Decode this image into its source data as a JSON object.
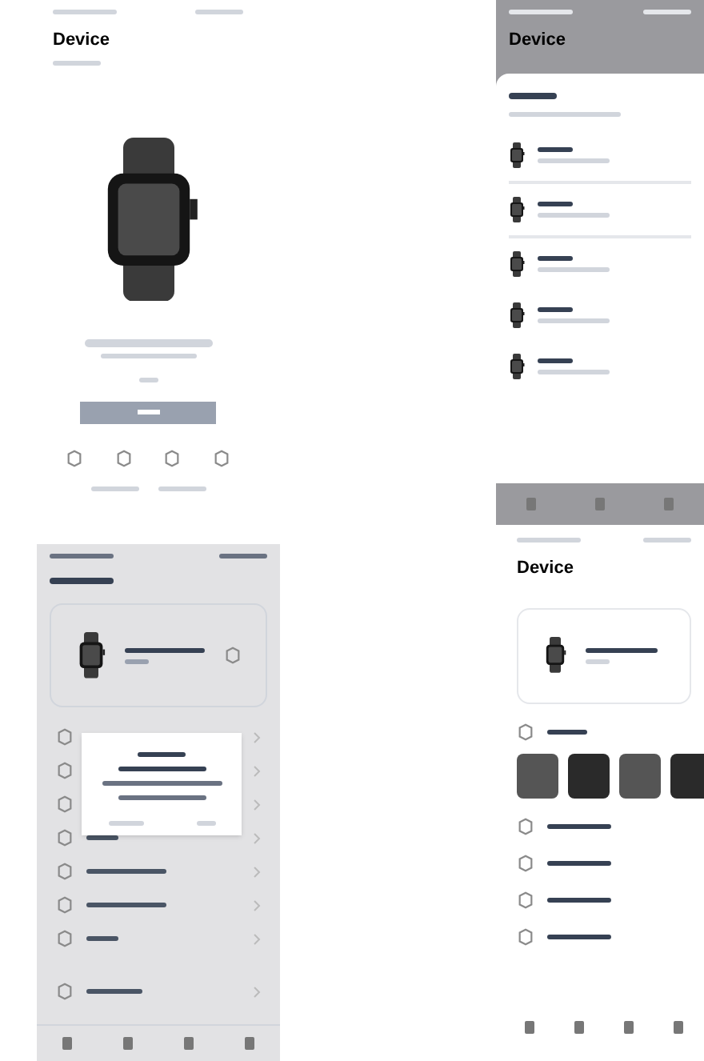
{
  "screens": [
    {
      "kind": "pairing",
      "title": "Device"
    },
    {
      "kind": "device_list",
      "title": "Device"
    },
    {
      "kind": "settings",
      "dialog_open": true
    },
    {
      "kind": "watch_detail",
      "title": "Device"
    }
  ]
}
